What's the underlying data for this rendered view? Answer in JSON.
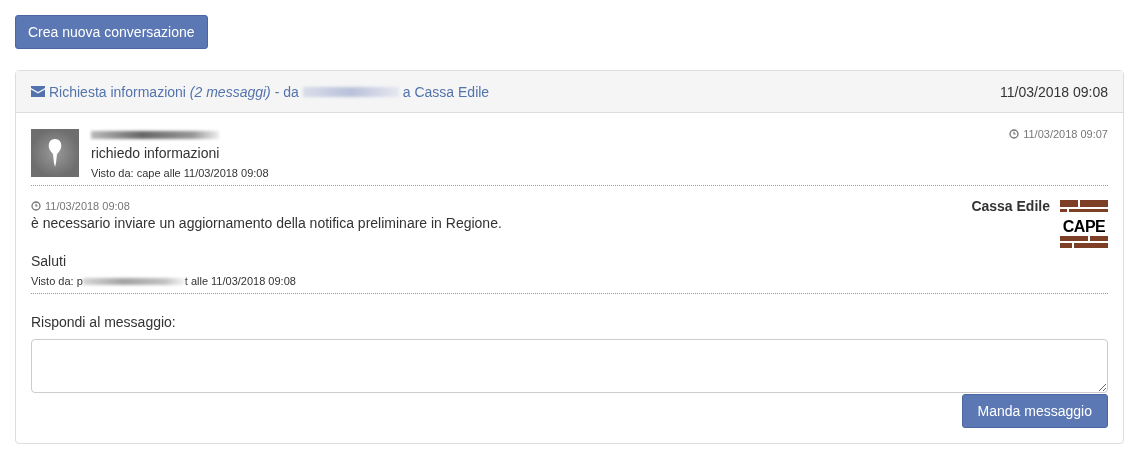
{
  "new_button": "Crea nuova conversazione",
  "conversation": {
    "title": "Richiesta informazioni *(2 messaggi)* - da",
    "recipient": "a Cassa Edile",
    "date": "11/03/2018 09:08",
    "messages": [
      {
        "kind": "user",
        "text": "richiedo informazioni",
        "time": "11/03/2018 09:07",
        "seen_prefix": "Visto da: cape alle 11/03/2018 09:08"
      },
      {
        "kind": "office",
        "sender": "Cassa Edile",
        "logo": "CAPE",
        "time": "11/03/2018 09:08",
        "text": "è necessario inviare un aggiornamento della notifica preliminare in Regione.",
        "closing": "Saluti",
        "seen_prefix": "Visto da: p",
        "seen_suffix": "t alle 11/03/2018 09:08"
      }
    ],
    "reply_label": "Rispondi al messaggio:",
    "send_button": "Manda messaggio"
  }
}
